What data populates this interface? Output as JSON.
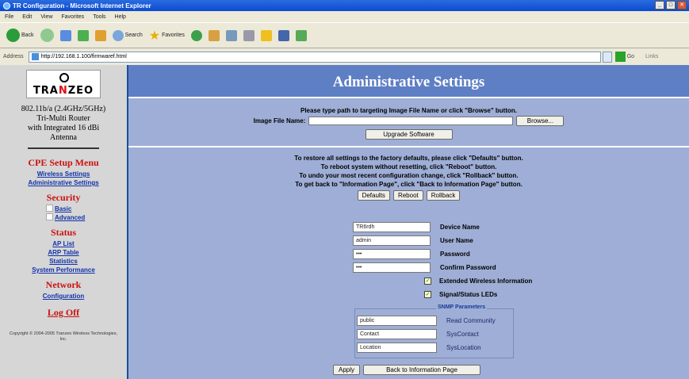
{
  "window": {
    "title": "TR Configuration - Microsoft Internet Explorer",
    "buttons": [
      "_",
      "□",
      "✕"
    ]
  },
  "menubar": [
    "File",
    "Edit",
    "View",
    "Favorites",
    "Tools",
    "Help"
  ],
  "toolbar": {
    "back": "Back",
    "search": "Search",
    "favorites": "Favorites"
  },
  "address": {
    "label": "Address",
    "url": "http://192.168.1.100/firmwaref.html",
    "go": "Go",
    "links": "Links"
  },
  "sidebar": {
    "logo_text_a": "TRA",
    "logo_text_n": "N",
    "logo_text_b": "ZEO",
    "product_lines": [
      "802.11b/a (2.4GHz/5GHz)",
      "Tri-Multi Router",
      "with Integrated 16 dBi",
      "Antenna"
    ],
    "cpe_menu_title": "CPE Setup Menu",
    "cpe_links": [
      "Wireless Settings",
      "Administrative Settings"
    ],
    "security_title": "Security",
    "security_links": [
      "Basic",
      "Advanced"
    ],
    "status_title": "Status",
    "status_links": [
      "AP List",
      "ARP Table",
      "Statistics",
      "System Performance"
    ],
    "network_title": "Network",
    "network_links": [
      "Configuration"
    ],
    "logoff": "Log Off",
    "copyright": "Copyright © 2004-2005 Tranzeo Wireless Technologies, Inc."
  },
  "main": {
    "title": "Administrative Settings",
    "upgrade_instruction": "Please type path to targeting Image File Name or click \"Browse\" button.",
    "image_file_label": "Image File Name:",
    "image_file_value": "",
    "browse_label": "Browse...",
    "upgrade_label": "Upgrade Software",
    "restore_lines": [
      "To restore all settings to the factory defaults, please click \"Defaults\" button.",
      "To reboot system without resetting, click \"Reboot\" button.",
      "To undo your most recent configuration change, click \"Rollback\" button.",
      "To get back to \"Information Page\", click \"Back to Information Page\" button."
    ],
    "defaults_label": "Defaults",
    "reboot_label": "Reboot",
    "rollback_label": "Rollback",
    "device_name_value": "TR6rdh",
    "device_name_label": "Device Name",
    "user_name_value": "admin",
    "user_name_label": "User Name",
    "password_value": "•••",
    "password_label": "Password",
    "confirm_password_value": "•••",
    "confirm_password_label": "Confirm Password",
    "extended_wireless_label": "Extended Wireless Information",
    "extended_wireless_checked": true,
    "signal_leds_label": "Signal/Status LEDs",
    "signal_leds_checked": true,
    "snmp_title": "SNMP Parameters",
    "read_community_value": "public",
    "read_community_label": "Read Community",
    "syscontact_value": "Contact",
    "syscontact_label": "SysContact",
    "syslocation_value": "Location",
    "syslocation_label": "SysLocation",
    "apply_label": "Apply",
    "back_info_label": "Back to Information Page"
  }
}
